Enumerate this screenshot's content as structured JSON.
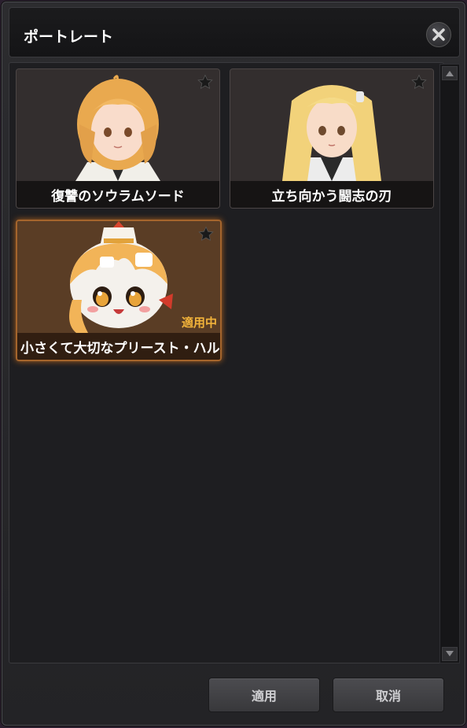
{
  "window": {
    "title": "ポートレート"
  },
  "portraits": [
    {
      "label": "復讐のソウラムソード",
      "favorite": false,
      "applied": false
    },
    {
      "label": "立ち向かう闘志の刃",
      "favorite": false,
      "applied": false
    },
    {
      "label": "小さくて大切なプリースト・ハル",
      "favorite": false,
      "applied": true,
      "status": "適用中"
    }
  ],
  "footer": {
    "apply_label": "適用",
    "cancel_label": "取消"
  },
  "colors": {
    "accent_applied": "#f2b33a",
    "active_border": "#a5652c"
  },
  "icons": {
    "close": "close-icon",
    "favorite": "star-icon",
    "scroll_up": "arrow-up-icon",
    "scroll_down": "arrow-down-icon"
  }
}
